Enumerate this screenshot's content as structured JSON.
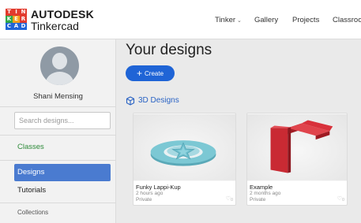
{
  "app": {
    "logo_letters": [
      {
        "letter": "T",
        "color": "#e23b2e"
      },
      {
        "letter": "I",
        "color": "#e23b2e"
      },
      {
        "letter": "N",
        "color": "#e23b2e"
      },
      {
        "letter": "K",
        "color": "#30a84a"
      },
      {
        "letter": "E",
        "color": "#f4a21c"
      },
      {
        "letter": "R",
        "color": "#e23b2e"
      },
      {
        "letter": "C",
        "color": "#1f64d6"
      },
      {
        "letter": "A",
        "color": "#1f64d6"
      },
      {
        "letter": "D",
        "color": "#1f64d6"
      }
    ],
    "brand_line1": "AUTODESK",
    "brand_line2": "Tinkercad"
  },
  "nav": {
    "tinker": "Tinker",
    "gallery": "Gallery",
    "projects": "Projects",
    "classrooms": "Classroo"
  },
  "sidebar": {
    "username": "Shani Mensing",
    "search_placeholder": "Search designs...",
    "classes": "Classes",
    "designs": "Designs",
    "tutorials": "Tutorials",
    "collections": "Collections"
  },
  "main": {
    "title": "Your designs",
    "create_label": "Create",
    "section_title": "3D Designs",
    "designs": [
      {
        "name": "Funky Lappi-Kup",
        "time": "2 hours ago",
        "visibility": "Private",
        "likes": "0"
      },
      {
        "name": "Example",
        "time": "2 months ago",
        "visibility": "Private",
        "likes": "0"
      }
    ]
  },
  "colors": {
    "accent_blue": "#1f64d6",
    "sidebar_active": "#4a7bd0",
    "classes_green": "#2e8b3a",
    "model_cyan": "#7cc8d4",
    "model_red": "#d8313b"
  }
}
